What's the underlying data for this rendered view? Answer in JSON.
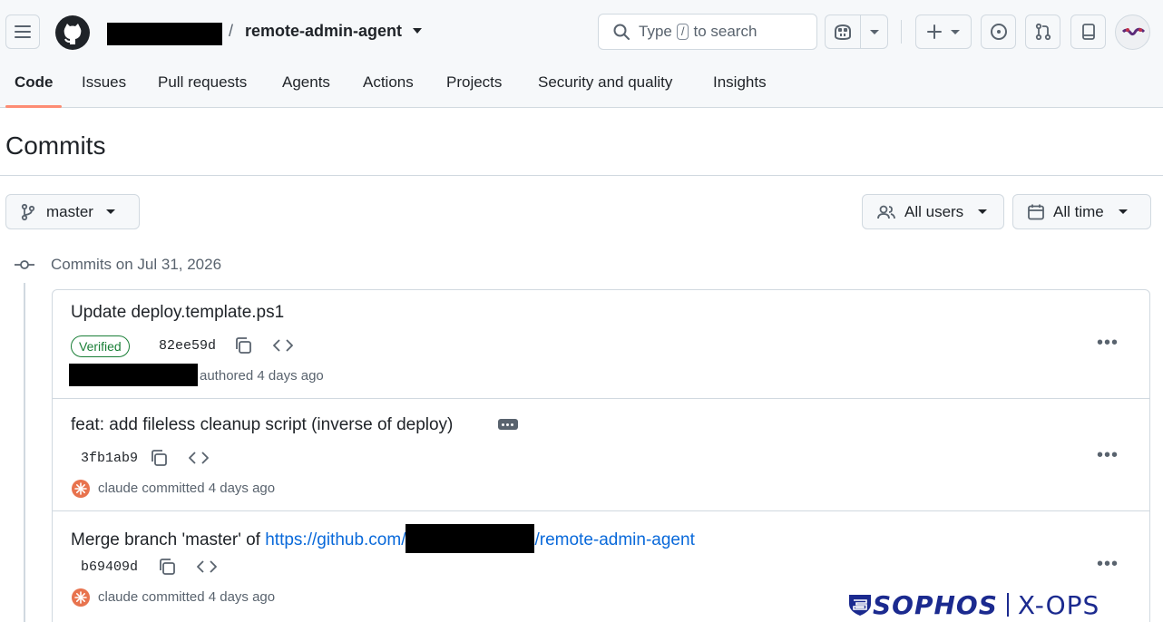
{
  "header": {
    "repo_name": "remote-admin-agent",
    "separator": "/",
    "search": {
      "prefix": "Type",
      "key": "/",
      "suffix": "to search"
    }
  },
  "tabs": [
    {
      "label": "Code",
      "active": true
    },
    {
      "label": "Issues"
    },
    {
      "label": "Pull requests"
    },
    {
      "label": "Agents"
    },
    {
      "label": "Actions"
    },
    {
      "label": "Projects"
    },
    {
      "label": "Security and quality"
    },
    {
      "label": "Insights"
    }
  ],
  "page": {
    "title": "Commits",
    "branch": "master",
    "users_filter": "All users",
    "time_filter": "All time",
    "date_group": "Commits on Jul 31, 2026"
  },
  "commits": [
    {
      "title": "Update deploy.template.ps1",
      "verified": "Verified",
      "sha": "82ee59d",
      "meta": "authored 4 days ago"
    },
    {
      "title": "feat: add fileless cleanup script (inverse of deploy)",
      "sha": "3fb1ab9",
      "author": "claude",
      "meta": "committed 4 days ago"
    },
    {
      "title_prefix": "Merge branch 'master' of ",
      "title_link_a": "https://github.com/",
      "title_link_b": "/remote-admin-agent",
      "sha": "b69409d",
      "author": "claude",
      "meta": "committed 4 days ago"
    }
  ],
  "watermark": {
    "brand": "SOPHOS",
    "product": "X-OPS"
  },
  "colors": {
    "accent_underline": "#fd8c73",
    "link": "#0969da",
    "verified": "#1a7f37",
    "brand": "#1b2a8f"
  },
  "icons": [
    "menu-icon",
    "github-logo-icon",
    "search-icon",
    "copilot-icon",
    "plus-icon",
    "issue-icon",
    "pull-request-icon",
    "inbox-icon",
    "branch-icon",
    "people-icon",
    "calendar-icon",
    "commit-node-icon",
    "copy-icon",
    "code-icon",
    "kebab-icon"
  ]
}
